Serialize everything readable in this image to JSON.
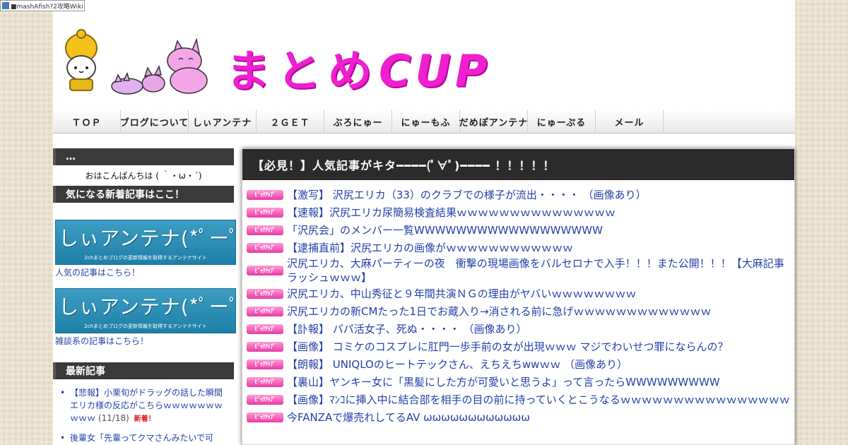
{
  "site": {
    "ribbon_text": "■mashAfish?2攻略Wiki",
    "logo_text_ja": "まとめ",
    "logo_text_latin": "CUP"
  },
  "nav": {
    "items": [
      "ＴＯＰ",
      "ブログについて",
      "しぃアンテナ",
      "２ＧＥＴ",
      "ぶろにゅー",
      "にゅーもふ",
      "だめぽアンテナ",
      "にゅーぷる",
      "メール"
    ]
  },
  "sidebar": {
    "box1_title": "…",
    "greeting": "おはこんばんちは ( ｀・ω・´)",
    "box2_title": "気になる新着記事はここ！",
    "banner_main": "しぃアンテナ(*ﾟーﾟ)",
    "banner_sub": "2chまとめブログの更新情報を取得するアンテナサイト",
    "link1": "人気の記事はこちら！",
    "link2": "雑談系の記事はこちら！",
    "recent_title": "最新記事",
    "recent": [
      {
        "title": "【悲報】小栗旬がドラッグの話した瞬間エリカ様の反応がこちらｗｗｗｗｗｗｗｗｗｗ",
        "date": "(11/18)",
        "badge": "新着！"
      },
      {
        "title": "後輩女「先輩ってクマさんみたいで可",
        "date": "",
        "badge": ""
      }
    ]
  },
  "main": {
    "heading": "【必見！】人気記事がキタ━━━━(ﾟ∀ﾟ)━━━━ ！！！！！",
    "pickup_label": "ﾋﾟｯｸｱｯﾌﾟ",
    "articles": [
      "【激写】 沢尻エリカ（33）のクラブでの様子が流出・・・・ （画像あり）",
      "【速報】沢尻エリカ尿簡易検査結果ｗｗｗｗｗｗｗｗｗｗｗｗｗｗｗ",
      "「沢尻会」のメンバー一覧WWWWWWWWWWWWWWWWWW",
      "【逮捕直前】沢尻エリカの画像がｗｗｗｗｗｗｗｗｗｗｗｗ",
      "沢尻エリカ、大麻パーティーの夜　衝撃の現場画像をバルセロナで入手！！！また公開！！！【大麻記事ラッシュｗｗｗ】",
      "沢尻エリカ、中山秀征と９年間共演ＮＧの理由がヤバいｗｗｗｗｗｗｗｗ",
      "沢尻エリカの新CMたった1日でお蔵入り→消される前に急げｗｗｗｗｗｗｗｗｗｗｗｗｗ",
      "【訃報】 パパ活女子、死ぬ・・・・ （画像あり）",
      "【画像】 コミケのコスプレに肛門一歩手前の女が出現ｗｗｗ マジでわいせつ罪にならんの？",
      "【朗報】 UNIQLOのヒートテックさん、えちえちwwｗｗ （画像あり）",
      "【裏山】ヤンキー女に「黒髪にした方が可愛いと思うよ」って言ったらWWWWWWWWW",
      "【画像】ﾏﾝｺに挿入中に結合部を相手の目の前に持っていくとこうなるｗｗｗｗｗｗｗｗｗｗｗｗｗｗｗｗ",
      "今FANZAで爆売れしてるAV ωωωωωωωωωωωω"
    ]
  },
  "colors": {
    "logo": "#f01fcf",
    "link": "#2440aa",
    "header_bar": "#2b2b2b",
    "pickup": "#e83aa6",
    "banner": "#2b8db8",
    "background": "#e9e1cf"
  }
}
